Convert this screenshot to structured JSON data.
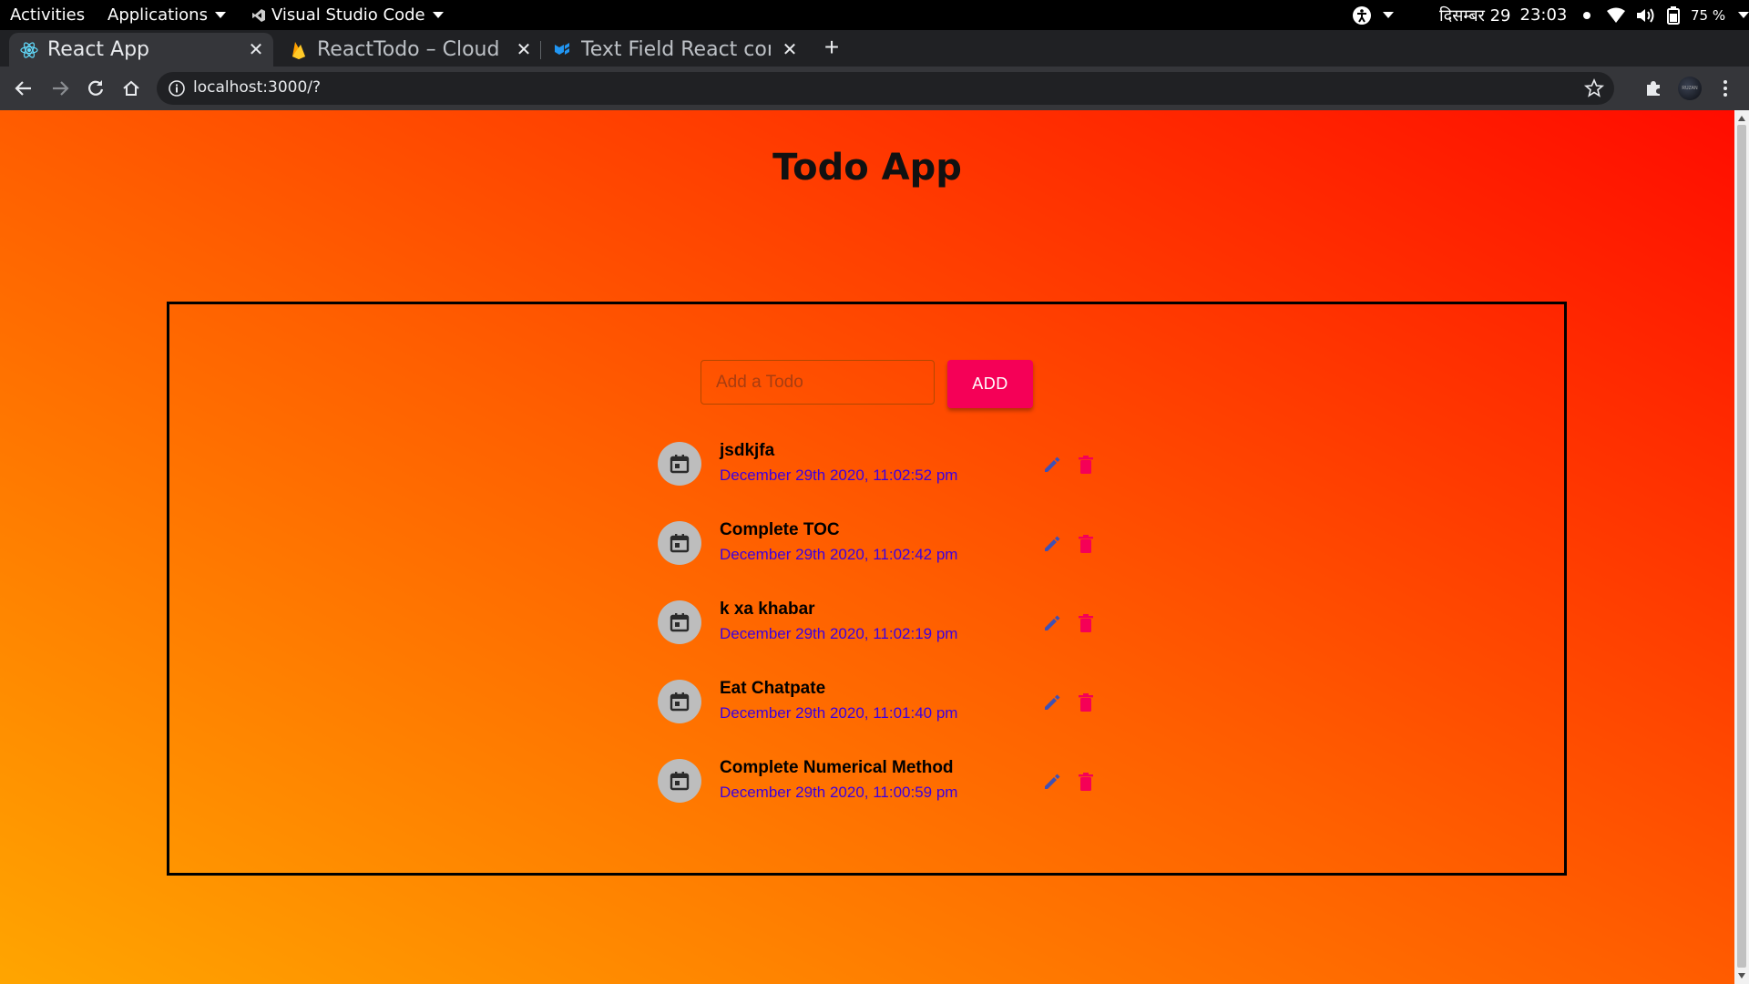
{
  "system_bar": {
    "activities": "Activities",
    "applications": "Applications",
    "focused_app": "Visual Studio Code",
    "date": "दिसम्बर 29",
    "time": "23:03",
    "battery": "75 %"
  },
  "browser": {
    "tabs": [
      {
        "title": "React App",
        "icon": "react-icon",
        "active": true
      },
      {
        "title": "ReactTodo – Cloud F",
        "icon": "firebase-icon",
        "active": false
      },
      {
        "title": "Text Field React con",
        "icon": "material-ui-icon",
        "active": false
      }
    ],
    "url": "localhost:3000/?",
    "profile_text": "RUZAN"
  },
  "app": {
    "title": "Todo App",
    "input_placeholder": "Add a Todo",
    "add_label": "ADD",
    "todos": [
      {
        "text": "jsdkjfa",
        "date": "December 29th 2020, 11:02:52 pm"
      },
      {
        "text": "Complete TOC",
        "date": "December 29th 2020, 11:02:42 pm"
      },
      {
        "text": "k xa khabar",
        "date": "December 29th 2020, 11:02:19 pm"
      },
      {
        "text": "Eat Chatpate",
        "date": "December 29th 2020, 11:01:40 pm"
      },
      {
        "text": "Complete Numerical Method",
        "date": "December 29th 2020, 11:00:59 pm"
      }
    ]
  },
  "colors": {
    "gradient_start": "#ffa500",
    "gradient_end": "#ff0c00",
    "add_button": "#f50057",
    "date_text": "#3d00e0",
    "edit_icon": "#3f51b5",
    "delete_icon": "#f50057"
  }
}
